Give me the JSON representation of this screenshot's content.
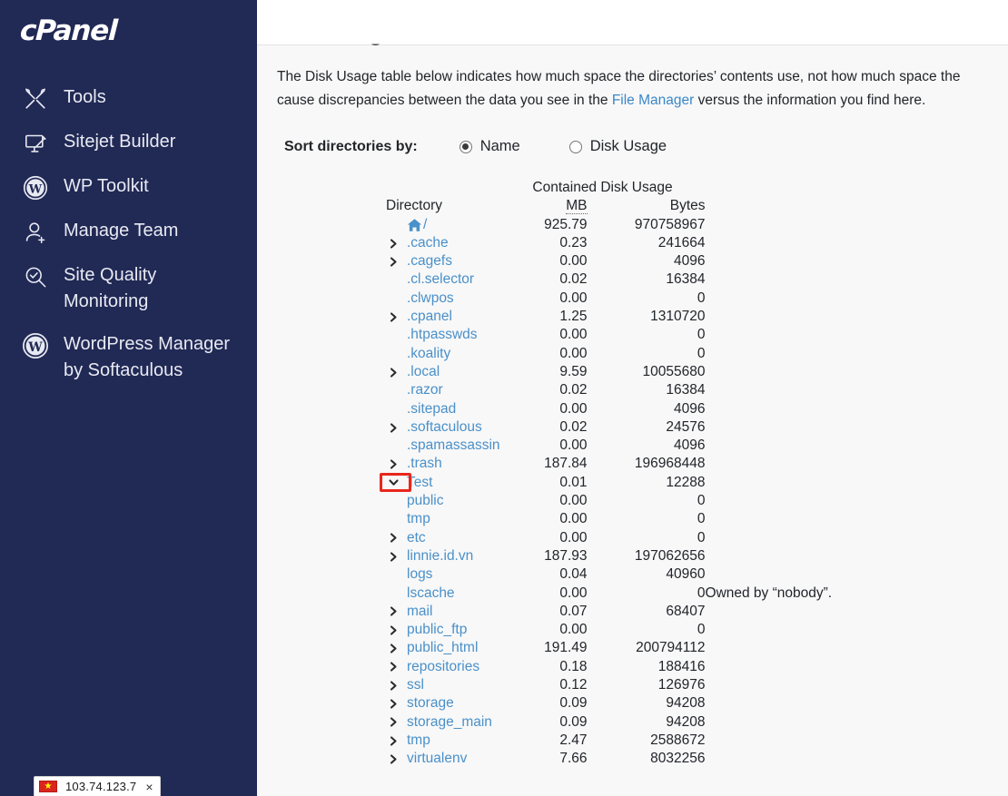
{
  "sidebar": {
    "logo": "cPanel",
    "items": [
      {
        "label": "Tools",
        "icon": "tools-icon"
      },
      {
        "label": "Sitejet Builder",
        "icon": "monitor-pen-icon"
      },
      {
        "label": "WP Toolkit",
        "icon": "wordpress-icon"
      },
      {
        "label": "Manage Team",
        "icon": "user-add-icon"
      },
      {
        "label": "Site Quality\nMonitoring",
        "icon": "search-check-icon"
      },
      {
        "label": "WordPress Manager\nby Softaculous",
        "icon": "wordpress-icon"
      }
    ],
    "ip_notice": {
      "ip": "103.74.123.7",
      "flag": "vietnam-flag-icon",
      "close": "×"
    }
  },
  "main": {
    "clipped_heading": "Disk Usage",
    "intro": {
      "before_link": "The Disk Usage table below indicates how much space the directories’ contents use, not how much space the ",
      "wrapped_text": "cause discrepancies between the data you see in the ",
      "link": "File Manager",
      "after_link": " versus the information you find here."
    },
    "sort": {
      "label": "Sort directories by:",
      "options": [
        {
          "label": "Name",
          "selected": true
        },
        {
          "label": "Disk Usage",
          "selected": false
        }
      ]
    },
    "table": {
      "group_header": "Contained Disk Usage",
      "headers": {
        "directory": "Directory",
        "mb": "MB",
        "bytes": "Bytes"
      },
      "rows": [
        {
          "name": "/",
          "mb": "925.79",
          "bytes": "970758967",
          "chevron": "none",
          "icon": "home-icon",
          "indent": 0,
          "note": ""
        },
        {
          "name": ".cache",
          "mb": "0.23",
          "bytes": "241664",
          "chevron": "right",
          "indent": 0,
          "note": ""
        },
        {
          "name": ".cagefs",
          "mb": "0.00",
          "bytes": "4096",
          "chevron": "right",
          "indent": 0,
          "note": ""
        },
        {
          "name": ".cl.selector",
          "mb": "0.02",
          "bytes": "16384",
          "chevron": "none",
          "indent": 0,
          "note": ""
        },
        {
          "name": ".clwpos",
          "mb": "0.00",
          "bytes": "0",
          "chevron": "none",
          "indent": 0,
          "note": ""
        },
        {
          "name": ".cpanel",
          "mb": "1.25",
          "bytes": "1310720",
          "chevron": "right",
          "indent": 0,
          "note": ""
        },
        {
          "name": ".htpasswds",
          "mb": "0.00",
          "bytes": "0",
          "chevron": "none",
          "indent": 0,
          "note": ""
        },
        {
          "name": ".koality",
          "mb": "0.00",
          "bytes": "0",
          "chevron": "none",
          "indent": 0,
          "note": ""
        },
        {
          "name": ".local",
          "mb": "9.59",
          "bytes": "10055680",
          "chevron": "right",
          "indent": 0,
          "note": ""
        },
        {
          "name": ".razor",
          "mb": "0.02",
          "bytes": "16384",
          "chevron": "none",
          "indent": 0,
          "note": ""
        },
        {
          "name": ".sitepad",
          "mb": "0.00",
          "bytes": "4096",
          "chevron": "none",
          "indent": 0,
          "note": ""
        },
        {
          "name": ".softaculous",
          "mb": "0.02",
          "bytes": "24576",
          "chevron": "right",
          "indent": 0,
          "note": ""
        },
        {
          "name": ".spamassassin",
          "mb": "0.00",
          "bytes": "4096",
          "chevron": "none",
          "indent": 0,
          "note": ""
        },
        {
          "name": ".trash",
          "mb": "187.84",
          "bytes": "196968448",
          "chevron": "right",
          "indent": 0,
          "note": ""
        },
        {
          "name": "Test",
          "mb": "0.01",
          "bytes": "12288",
          "chevron": "down",
          "indent": 0,
          "note": "",
          "highlighted": true
        },
        {
          "name": "public",
          "mb": "0.00",
          "bytes": "0",
          "chevron": "none",
          "indent": 1,
          "note": ""
        },
        {
          "name": "tmp",
          "mb": "0.00",
          "bytes": "0",
          "chevron": "none",
          "indent": 1,
          "note": ""
        },
        {
          "name": "etc",
          "mb": "0.00",
          "bytes": "0",
          "chevron": "right",
          "indent": 0,
          "note": ""
        },
        {
          "name": "linnie.id.vn",
          "mb": "187.93",
          "bytes": "197062656",
          "chevron": "right",
          "indent": 0,
          "note": ""
        },
        {
          "name": "logs",
          "mb": "0.04",
          "bytes": "40960",
          "chevron": "none",
          "indent": 0,
          "note": ""
        },
        {
          "name": "lscache",
          "mb": "0.00",
          "bytes": "0",
          "chevron": "none",
          "indent": 0,
          "note": "Owned by “nobody”."
        },
        {
          "name": "mail",
          "mb": "0.07",
          "bytes": "68407",
          "chevron": "right",
          "indent": 0,
          "note": ""
        },
        {
          "name": "public_ftp",
          "mb": "0.00",
          "bytes": "0",
          "chevron": "right",
          "indent": 0,
          "note": ""
        },
        {
          "name": "public_html",
          "mb": "191.49",
          "bytes": "200794112",
          "chevron": "right",
          "indent": 0,
          "note": ""
        },
        {
          "name": "repositories",
          "mb": "0.18",
          "bytes": "188416",
          "chevron": "right",
          "indent": 0,
          "note": ""
        },
        {
          "name": "ssl",
          "mb": "0.12",
          "bytes": "126976",
          "chevron": "right",
          "indent": 0,
          "note": ""
        },
        {
          "name": "storage",
          "mb": "0.09",
          "bytes": "94208",
          "chevron": "right",
          "indent": 0,
          "note": ""
        },
        {
          "name": "storage_main",
          "mb": "0.09",
          "bytes": "94208",
          "chevron": "right",
          "indent": 0,
          "note": ""
        },
        {
          "name": "tmp",
          "mb": "2.47",
          "bytes": "2588672",
          "chevron": "right",
          "indent": 0,
          "note": ""
        },
        {
          "name": "virtualenv",
          "mb": "7.66",
          "bytes": "8032256",
          "chevron": "right",
          "indent": 0,
          "note": ""
        }
      ]
    }
  },
  "colors": {
    "sidebar_bg": "#212955",
    "content_bg": "#f8f8f8",
    "link": "#4a90c9",
    "annotation": "#e8261b",
    "text": "#22252a"
  }
}
